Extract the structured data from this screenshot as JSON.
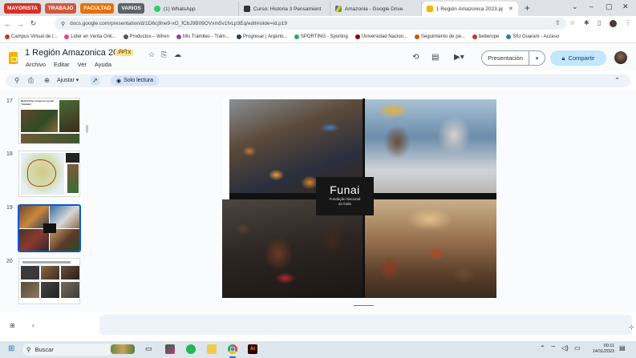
{
  "browser": {
    "tab_groups": [
      {
        "label": "MAYORISTA",
        "color": "#d93025"
      },
      {
        "label": "TRABAJO",
        "color": "#d05a3c"
      },
      {
        "label": "FACULTAD",
        "color": "#e8710a"
      },
      {
        "label": "VARIOS",
        "color": "#5f6368"
      }
    ],
    "tabs": [
      {
        "title": "(1) WhatsApp",
        "favicon_color": "#25d366"
      },
      {
        "title": "Curso: Historia 3 Pensamient",
        "favicon_color": "#333333"
      },
      {
        "title": "Amazonia - Google Drive",
        "favicon_color": "#1a73e8"
      },
      {
        "title": "1 Región Amazonica 2023.pp",
        "favicon_color": "#f4b400",
        "active": true
      }
    ],
    "url": "docs.google.com/presentation/d/1D6cj9ne9-xO_fCbJ9B09OVxm5v1fvLp3Eq/edit#slide=id.p19",
    "bookmarks": [
      {
        "label": "Campus Virtual de l...",
        "color": "#c0392b"
      },
      {
        "label": "Líder en Venta Onli...",
        "color": "#e84393"
      },
      {
        "label": "Productos – Wiren",
        "color": "#555555"
      },
      {
        "label": "Mis Trámites - Trám...",
        "color": "#8e44ad"
      },
      {
        "label": "Progresar | Argenti...",
        "color": "#2c3e50"
      },
      {
        "label": "SPORTING - Sporting",
        "color": "#27ae60"
      },
      {
        "label": "Universidad Nacion...",
        "color": "#8b0000"
      },
      {
        "label": "Seguimiento de pe...",
        "color": "#d35400"
      },
      {
        "label": "betterope",
        "color": "#c0392b"
      },
      {
        "label": "SIU Guaraní - Acceso",
        "color": "#2980b9"
      }
    ]
  },
  "app": {
    "title": "1 Región Amazonica 2023",
    "badge": ".PPTX",
    "menu": [
      "Archivo",
      "Editar",
      "Ver",
      "Ayuda"
    ],
    "present_label": "Presentación",
    "share_label": "Compartir",
    "toolbar": {
      "adjust_label": "Ajustar",
      "readonly_label": "Solo lectura"
    }
  },
  "filmstrip": {
    "slides": [
      {
        "number": "17",
        "heading": "Basil Prime rompe la Ley del 'Cazador'.",
        "selected": false
      },
      {
        "number": "18",
        "selected": false
      },
      {
        "number": "19",
        "selected": true
      },
      {
        "number": "20",
        "selected": false
      }
    ]
  },
  "slide": {
    "logo_name": "Funai",
    "logo_sub_line1": "Fundação Nacional",
    "logo_sub_line2": "do Índio"
  },
  "taskbar": {
    "search_label": "Buscar",
    "time": "00:11",
    "date": "14/11/2023"
  }
}
